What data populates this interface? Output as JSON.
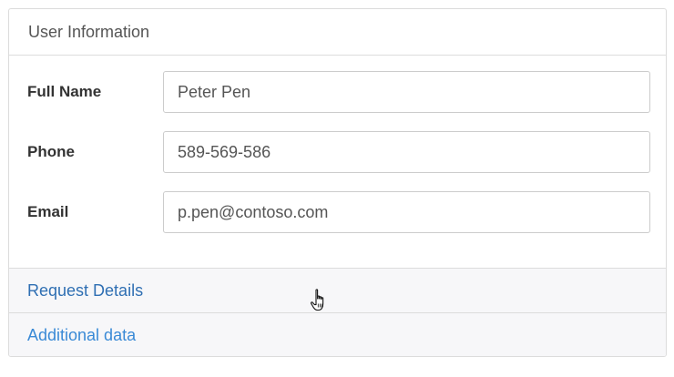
{
  "panel": {
    "header": "User Information"
  },
  "form": {
    "fields": [
      {
        "label": "Full Name",
        "value": "Peter Pen"
      },
      {
        "label": "Phone",
        "value": "589-569-586"
      },
      {
        "label": "Email",
        "value": "p.pen@contoso.com"
      }
    ]
  },
  "accordion": {
    "items": [
      {
        "label": "Request Details"
      },
      {
        "label": "Additional data"
      }
    ]
  },
  "cursor": {
    "icon": "hand-pointer-icon"
  },
  "colors": {
    "link": "#2f6fb3",
    "border": "#dcdcdc",
    "accordion_bg": "#f7f7f9"
  }
}
